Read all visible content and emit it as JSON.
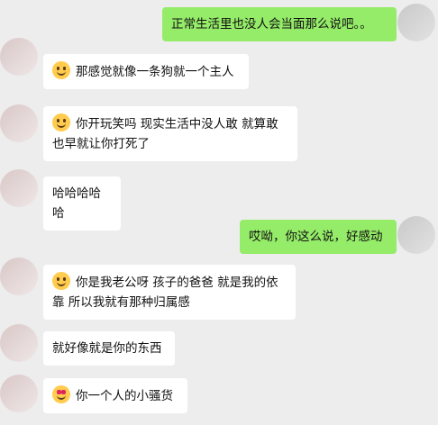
{
  "messages": [
    {
      "side": "right",
      "text": "正常生活里也没人会当面那么说吧。。"
    },
    {
      "side": "left",
      "emoji": "laughing-tears",
      "text": "那感觉就像一条狗就一个主人"
    },
    {
      "side": "left",
      "emoji": "unamused-face",
      "text": "你开玩笑吗 现实生活中没人敢 就算敢也早就让你打死了"
    },
    {
      "side": "left",
      "text": "哈哈哈哈哈"
    },
    {
      "side": "right",
      "text": "哎呦，你这么说，好感动"
    },
    {
      "side": "left",
      "emoji": "pleading-face",
      "text": "你是我老公呀 孩子的爸爸 就是我的依靠 所以我就有那种归属感"
    },
    {
      "side": "left",
      "text": "就好像就是你的东西"
    },
    {
      "side": "left",
      "emoji": "heart-eyes",
      "text": "你一个人的小骚货"
    }
  ],
  "colors": {
    "me_bubble": "#95ec69",
    "other_bubble": "#ffffff",
    "background": "#ededed"
  }
}
